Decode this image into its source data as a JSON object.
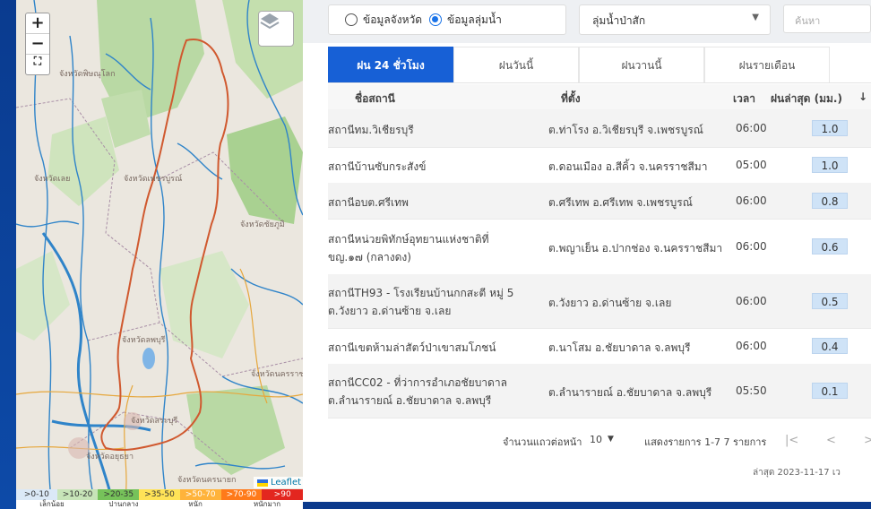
{
  "map": {
    "zoom_in": "+",
    "zoom_out": "−",
    "reset": "⛶",
    "attribution": "Leaflet",
    "labels": [
      {
        "text": "จังหวัดพิษณุโลก"
      },
      {
        "text": "จังหวัดเพชรบูรณ์"
      },
      {
        "text": "จังหวัดลพบุรี"
      },
      {
        "text": "จังหวัดชัยภูมิ"
      },
      {
        "text": "จังหวัดสระบุรี"
      },
      {
        "text": "จังหวัดนครราชสีมา"
      },
      {
        "text": "จังหวัดอยุธยา"
      },
      {
        "text": "จังหวัดนครนายก"
      },
      {
        "text": "จังหวัดเลย"
      }
    ],
    "legend": {
      "ranges": [
        {
          "label": ">0-10",
          "color": "#dbe9f7"
        },
        {
          "label": ">10-20",
          "color": "#c7e4b8"
        },
        {
          "label": ">20-35",
          "color": "#76c25a"
        },
        {
          "label": ">35-50",
          "color": "#ffe357"
        },
        {
          "label": ">50-70",
          "color": "#ffb33b"
        },
        {
          "label": ">70-90",
          "color": "#ff7a1a"
        },
        {
          "label": ">90",
          "color": "#e3261f"
        }
      ],
      "names": [
        "เล็กน้อย",
        "ปานกลาง",
        "หนัก",
        "หนักมาก"
      ]
    }
  },
  "filter": {
    "radio_province": "ข้อมูลจังหวัด",
    "radio_basin": "ข้อมูลลุ่มน้ำ",
    "basin_select": "ลุ่มน้ำป่าสัก",
    "search_placeholder": "ค้นหา"
  },
  "tabs": [
    "ฝน 24 ชั่วโมง",
    "ฝนวันนี้",
    "ฝนวานนี้",
    "ฝนรายเดือน"
  ],
  "table": {
    "headers": {
      "name": "ชื่อสถานี",
      "location": "ที่ตั้ง",
      "time": "เวลา",
      "rain": "ฝนล่าสุด (มม.)",
      "sort_icon": "↓"
    },
    "rows": [
      {
        "name": "สถานีทม.วิเชียรบุรี",
        "name2": "",
        "location": "ต.ท่าโรง อ.วิเชียรบุรี จ.เพชรบูรณ์",
        "time": "06:00",
        "rain": "1.0"
      },
      {
        "name": "สถานีบ้านซับกระสังข์",
        "name2": "",
        "location": "ต.ดอนเมือง อ.สีคิ้ว จ.นครราชสีมา",
        "time": "05:00",
        "rain": "1.0"
      },
      {
        "name": "สถานีอบต.ศรีเทพ",
        "name2": "",
        "location": "ต.ศรีเทพ อ.ศรีเทพ จ.เพชรบูรณ์",
        "time": "06:00",
        "rain": "0.8"
      },
      {
        "name": "สถานีหน่วยพิทักษ์อุทยานแห่งชาติที่",
        "name2": "ขญ.๑๗ (กลางดง)",
        "location": "ต.พญาเย็น อ.ปากช่อง จ.นครราชสีมา",
        "time": "06:00",
        "rain": "0.6"
      },
      {
        "name": "สถานีTH93 - โรงเรียนบ้านกกสะตี หมู่ 5",
        "name2": "ต.วังยาว อ.ด่านซ้าย จ.เลย",
        "location": "ต.วังยาว อ.ด่านซ้าย จ.เลย",
        "time": "06:00",
        "rain": "0.5"
      },
      {
        "name": "สถานีเขตห้ามล่าสัตว์ป่าเขาสมโภชน์",
        "name2": "",
        "location": "ต.นาโสม อ.ชัยบาดาล จ.ลพบุรี",
        "time": "06:00",
        "rain": "0.4"
      },
      {
        "name": "สถานีCC02 - ที่ว่าการอำเภอชัยบาดาล",
        "name2": "ต.ลำนารายณ์ อ.ชัยบาดาล จ.ลพบุรี",
        "location": "ต.ลำนารายณ์ อ.ชัยบาดาล จ.ลพบุรี",
        "time": "05:50",
        "rain": "0.1"
      }
    ]
  },
  "pagination": {
    "rows_per_page_label": "จำนวนแถวต่อหน้า",
    "rows_per_page": "10",
    "range_label": "แสดงรายการ 1-7 7 รายการ",
    "first": "|<",
    "prev": "<",
    "next": ">"
  },
  "updated": "ล่าสุด 2023-11-17 เว"
}
